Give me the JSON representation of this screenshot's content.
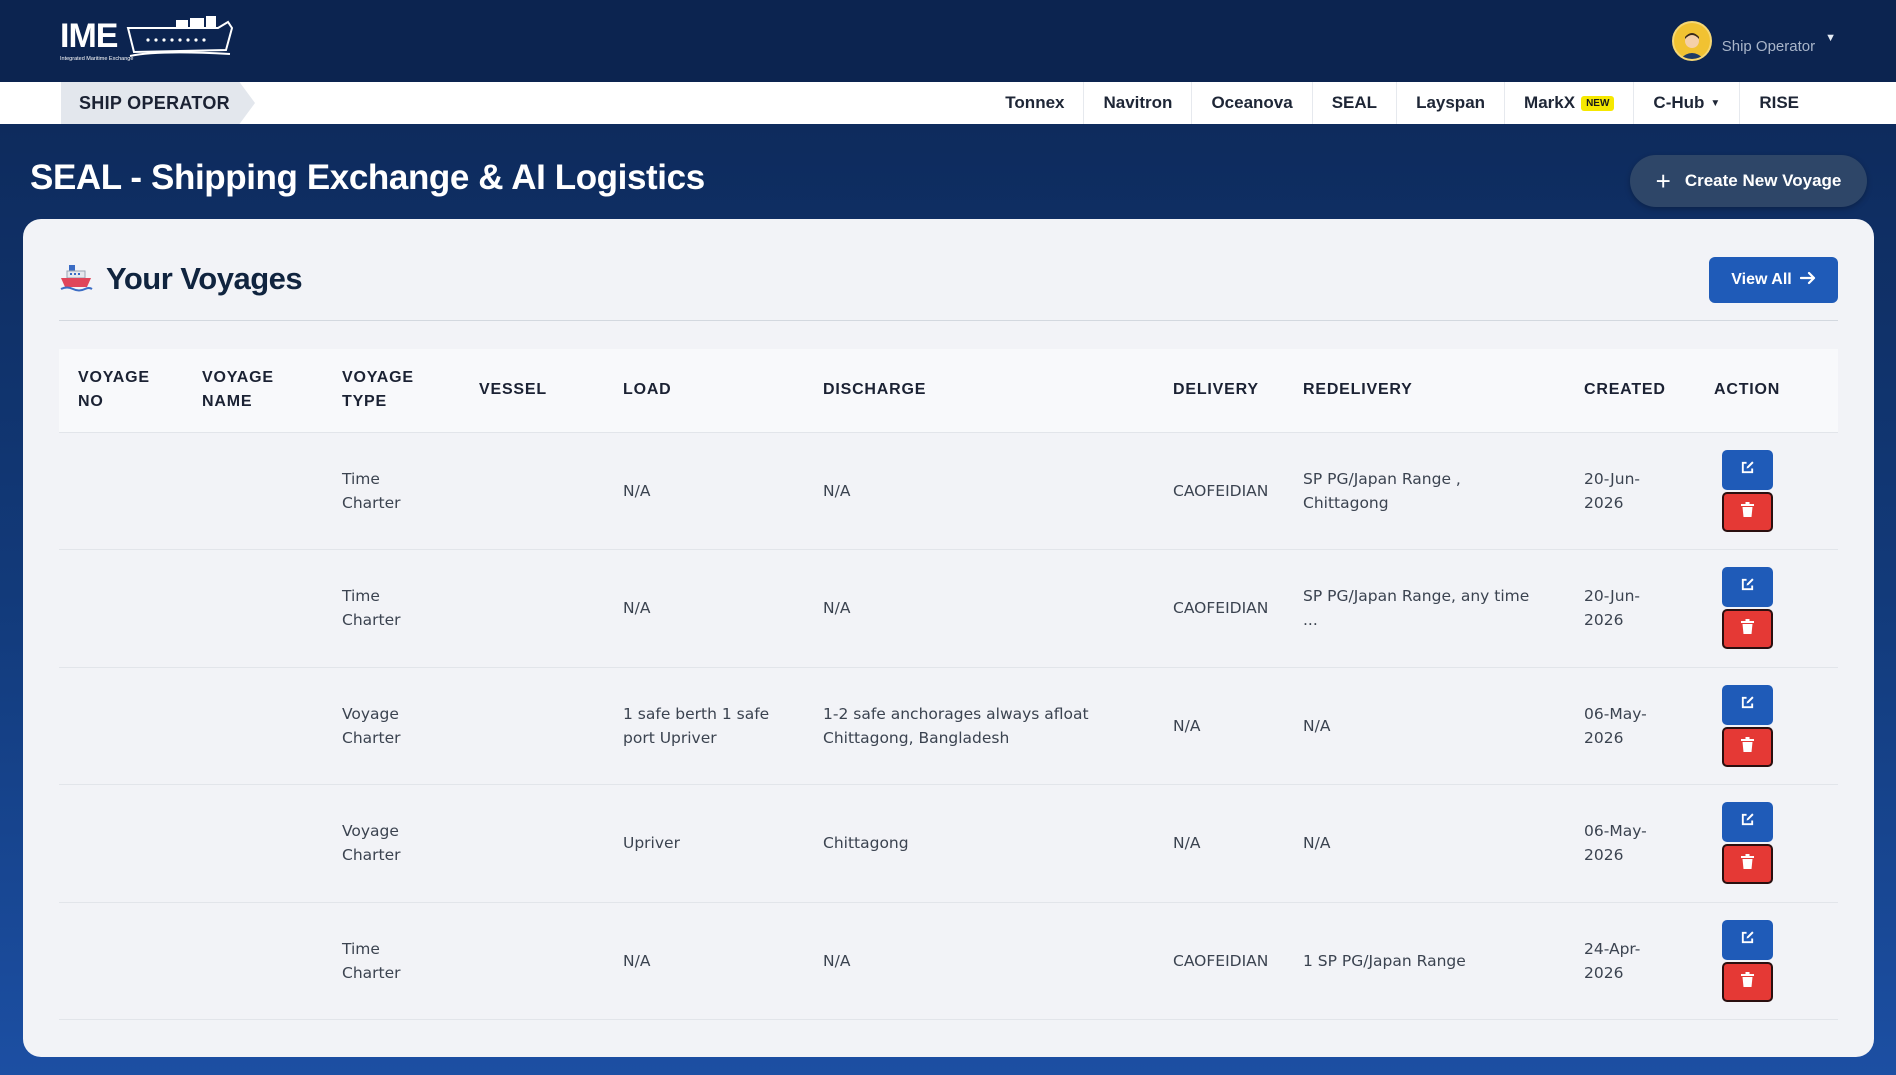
{
  "header": {
    "logo_text": "IME",
    "logo_subtitle": "Integrated Maritime Exchange",
    "user_name": "Ship Operator"
  },
  "subnav": {
    "role": "SHIP OPERATOR",
    "links": [
      {
        "label": "Tonnex"
      },
      {
        "label": "Navitron"
      },
      {
        "label": "Oceanova"
      },
      {
        "label": "SEAL"
      },
      {
        "label": "Layspan"
      },
      {
        "label": "MarkX",
        "badge": "NEW"
      },
      {
        "label": "C-Hub",
        "dropdown": true
      },
      {
        "label": "RISE"
      }
    ]
  },
  "page": {
    "title": "SEAL - Shipping Exchange & AI Logistics",
    "create_button": "Create New Voyage"
  },
  "voyages": {
    "title": "Your Voyages",
    "view_all": "View All",
    "columns": [
      "VOYAGE NO",
      "VOYAGE NAME",
      "VOYAGE TYPE",
      "VESSEL",
      "LOAD",
      "DISCHARGE",
      "DELIVERY",
      "REDELIVERY",
      "CREATED",
      "ACTION"
    ],
    "rows": [
      {
        "voyage_no": "",
        "voyage_name": "",
        "type": "Time Charter",
        "vessel": "",
        "load": "N/A",
        "discharge": "N/A",
        "delivery": "CAOFEIDIAN",
        "redelivery": "SP PG/Japan Range , Chittagong",
        "created": "20-Jun-2026"
      },
      {
        "voyage_no": "",
        "voyage_name": "",
        "type": "Time Charter",
        "vessel": "",
        "load": "N/A",
        "discharge": "N/A",
        "delivery": "CAOFEIDIAN",
        "redelivery": "SP PG/Japan Range, any time ...",
        "created": "20-Jun-2026"
      },
      {
        "voyage_no": "",
        "voyage_name": "",
        "type": "Voyage Charter",
        "vessel": "",
        "load": "1 safe berth 1 safe port Upriver",
        "discharge": "1-2 safe anchorages always afloat Chittagong, Bangladesh",
        "delivery": "N/A",
        "redelivery": "N/A",
        "created": "06-May-2026"
      },
      {
        "voyage_no": "",
        "voyage_name": "",
        "type": "Voyage Charter",
        "vessel": "",
        "load": "Upriver",
        "discharge": "Chittagong",
        "delivery": "N/A",
        "redelivery": "N/A",
        "created": "06-May-2026"
      },
      {
        "voyage_no": "",
        "voyage_name": "",
        "type": "Time Charter",
        "vessel": "",
        "load": "N/A",
        "discharge": "N/A",
        "delivery": "CAOFEIDIAN",
        "redelivery": "1 SP PG/Japan Range",
        "created": "24-Apr-2026"
      }
    ]
  },
  "icons": {
    "create": "plus-icon",
    "view_all": "arrow-right-icon",
    "edit": "edit-icon",
    "delete": "trash-icon",
    "title": "ship-icon"
  },
  "colors": {
    "primary": "#1f5bb8",
    "danger": "#e53935",
    "navy": "#0c2450"
  }
}
